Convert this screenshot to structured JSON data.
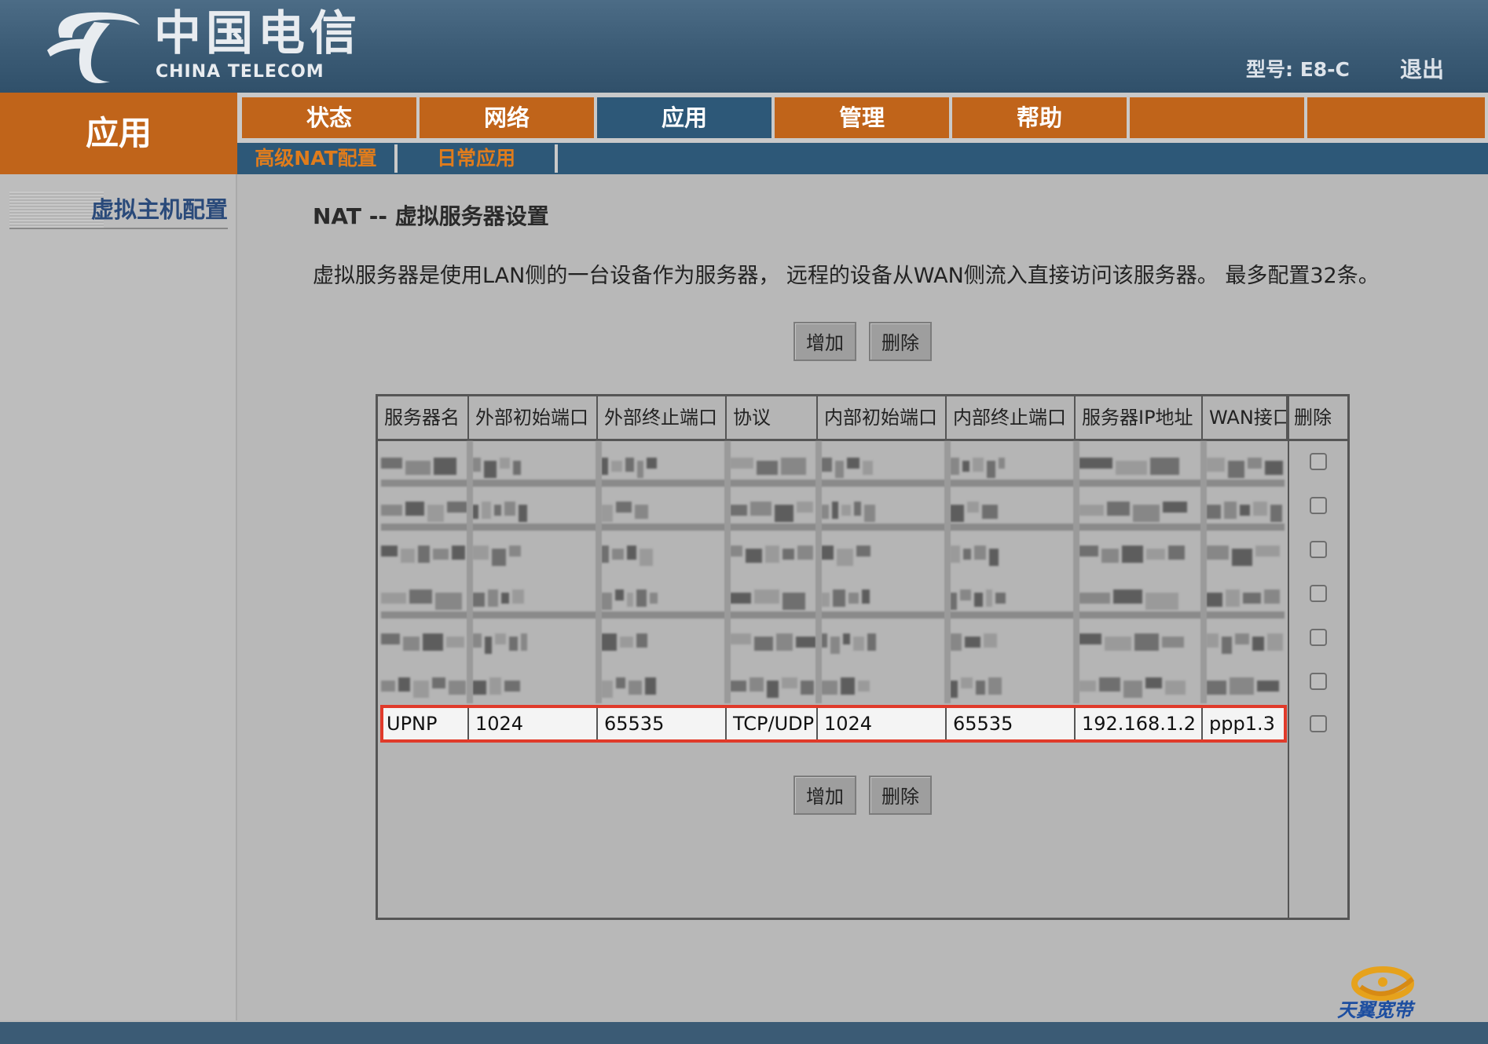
{
  "header": {
    "logo_cn": "中国电信",
    "logo_en": "CHINA TELECOM",
    "model": "型号: E8-C",
    "logout": "退出"
  },
  "section_label": "应用",
  "nav": {
    "tabs": [
      {
        "label": "状态",
        "active": false
      },
      {
        "label": "网络",
        "active": false
      },
      {
        "label": "应用",
        "active": true
      },
      {
        "label": "管理",
        "active": false
      },
      {
        "label": "帮助",
        "active": false
      },
      {
        "label": "",
        "active": false
      },
      {
        "label": "",
        "active": false
      }
    ],
    "subtabs": [
      {
        "label": "高级NAT配置"
      },
      {
        "label": "日常应用"
      }
    ]
  },
  "sidebar": {
    "items": [
      {
        "label": "虚拟主机配置"
      }
    ]
  },
  "main": {
    "title": "NAT -- 虚拟服务器设置",
    "description": "虚拟服务器是使用LAN侧的一台设备作为服务器， 远程的设备从WAN侧流入直接访问该服务器。 最多配置32条。",
    "add_label": "增加",
    "delete_label": "删除"
  },
  "table": {
    "headers": [
      "服务器名",
      "外部初始端口",
      "外部终止端口",
      "协议",
      "内部初始端口",
      "内部终止端口",
      "服务器IP地址",
      "WAN接口",
      "删除"
    ],
    "blurred_rows": 6,
    "visible_row": {
      "server_name": "UPNP",
      "ext_start": "1024",
      "ext_end": "65535",
      "protocol": "TCP/UDP",
      "int_start": "1024",
      "int_end": "65535",
      "server_ip": "192.168.1.2",
      "wan": "ppp1.3"
    }
  },
  "footer": {
    "brand": "天翼宽带"
  },
  "colors": {
    "header": "#3b5b75",
    "orange": "#c0641a",
    "nav_active": "#2d5878",
    "highlight": "#e03a2a",
    "page_bg": "#b8b8b8"
  }
}
